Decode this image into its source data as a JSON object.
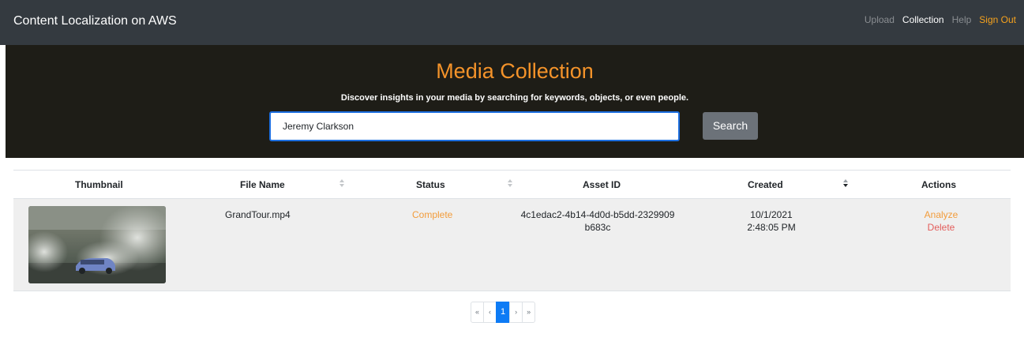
{
  "navbar": {
    "brand": "Content Localization on AWS",
    "links": [
      {
        "label": "Upload"
      },
      {
        "label": "Collection"
      },
      {
        "label": "Help"
      },
      {
        "label": "Sign Out"
      }
    ]
  },
  "hero": {
    "title": "Media Collection",
    "subtitle": "Discover insights in your media by searching for keywords, objects, or even people.",
    "search_value": "Jeremy Clarkson",
    "search_button": "Search"
  },
  "table": {
    "columns": [
      "Thumbnail",
      "File Name",
      "Status",
      "Asset ID",
      "Created",
      "Actions"
    ],
    "rows": [
      {
        "file_name": "GrandTour.mp4",
        "status": "Complete",
        "asset_id_line1": "4c1edac2-4b14-4d0d-b5dd-2329909",
        "asset_id_line2": "b683c",
        "created_date": "10/1/2021",
        "created_time": "2:48:05 PM",
        "action_analyze": "Analyze",
        "action_delete": "Delete"
      }
    ]
  },
  "pagination": {
    "first": "«",
    "prev": "‹",
    "current": "1",
    "next": "›",
    "last": "»"
  },
  "colors": {
    "accent_orange": "#f4932a",
    "link_red": "#e35d5b",
    "navbar_bg": "#343a40",
    "hero_bg": "#1e1d17",
    "active_page": "#0d7bf5"
  }
}
